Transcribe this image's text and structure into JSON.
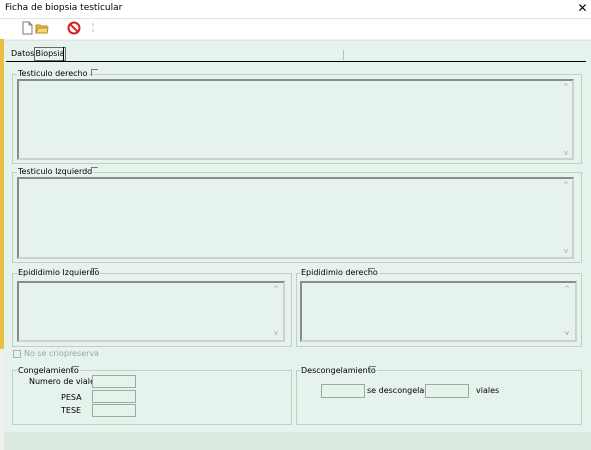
{
  "window": {
    "title": "Ficha de biopsia testicular",
    "close_glyph": "✕"
  },
  "toolbar": {
    "new_icon": "new-document-icon",
    "open_icon": "open-folder-icon",
    "cancel_icon": "cancel-icon",
    "separator_icon": "separator-icon"
  },
  "tabs": {
    "datos": "Datos",
    "biopsia": "Biopsia"
  },
  "sections": {
    "testiculo_derecho": "Testiculo derecho",
    "testiculo_izquierdo": "Testiculo Izquierdo",
    "epididimio_izquierdo": "Epididimio Izquierdo",
    "epididimio_derecho": "Epididimio derecho"
  },
  "cryo": {
    "no_criopreserva": "No se criopreserva",
    "congelamiento": "Congelamiento",
    "numero_viales": "Numero de viales",
    "pesa": "PESA",
    "tese": "TESE",
    "descongelamiento": "Descongelamiento",
    "se_descongelan": "se descongelan",
    "viales": "viales"
  },
  "scroll": {
    "up": "^",
    "down": "v"
  },
  "colors": {
    "panel": "#e6f3ec",
    "titlebar": "#ffffff",
    "cancel_red": "#d81e1e",
    "folder": "#f0c040"
  }
}
